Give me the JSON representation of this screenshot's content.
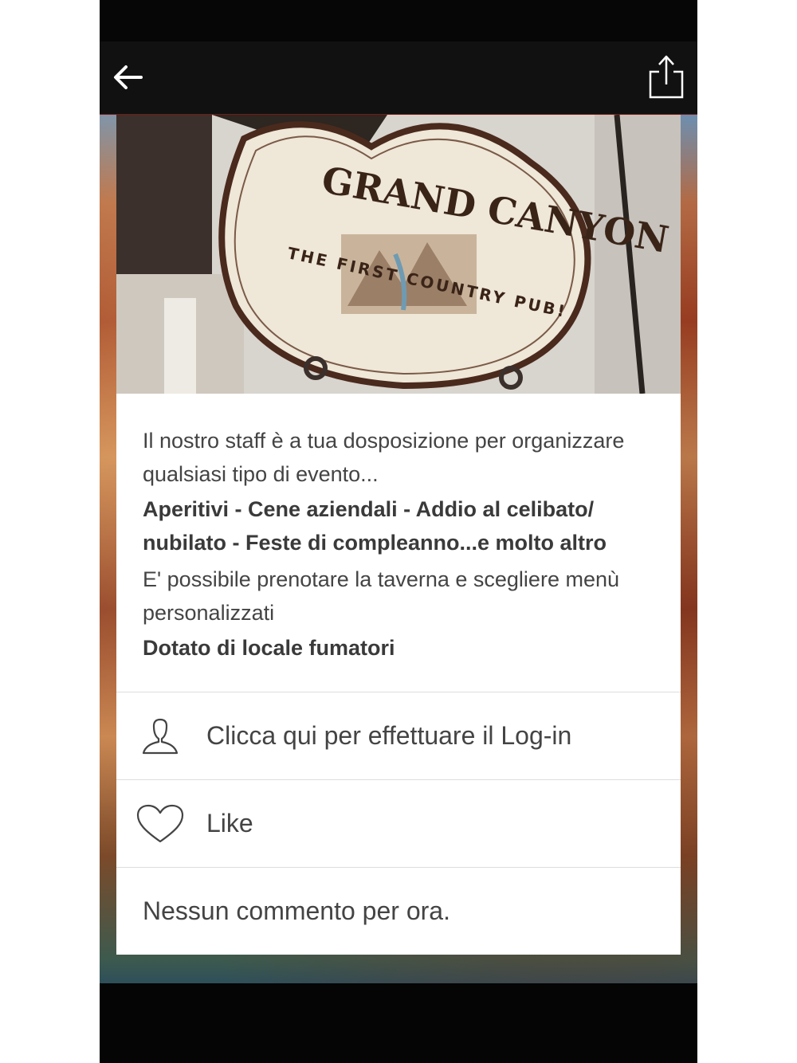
{
  "header": {
    "back_icon": "back-arrow-icon",
    "share_icon": "share-icon"
  },
  "hero": {
    "sign_title": "GRAND CANYON",
    "sign_subtitle": "THE FIRST COUNTRY PUB!"
  },
  "description": {
    "intro": "Il nostro staff è a tua dosposizione per organizzare qualsiasi tipo di evento...",
    "events": "Aperitivi - Cene aziendali - Addio al celibato/ nubilato - Feste di compleanno...e molto altro",
    "booking": "E' possibile prenotare la taverna e scegliere menù personalizzati",
    "smokers": "Dotato di locale fumatori"
  },
  "actions": {
    "login_label": "Clicca qui per effettuare il Log-in",
    "login_icon": "user-icon",
    "like_label": "Like",
    "like_icon": "heart-icon"
  },
  "comments": {
    "empty_label": "Nessun commento per ora."
  }
}
